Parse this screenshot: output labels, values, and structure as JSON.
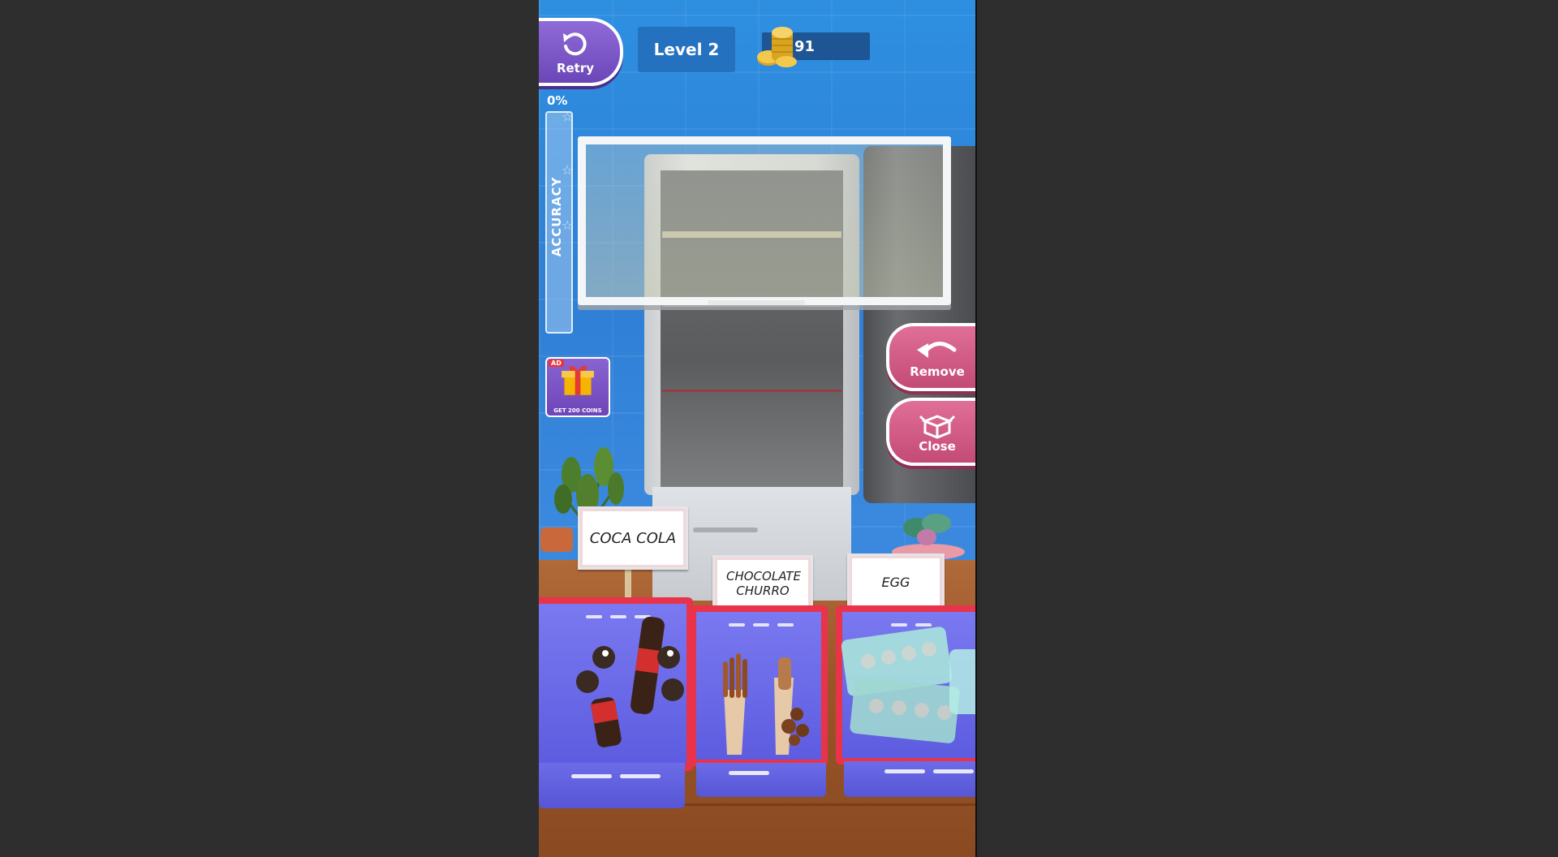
{
  "hud": {
    "retry_label": "Retry",
    "level_label": "Level 2",
    "coins": "91"
  },
  "accuracy": {
    "percent_label": "0%",
    "label": "ACCURACY",
    "value_percent": 0
  },
  "gift": {
    "ad_tag": "AD",
    "label": "GET 200 COINS"
  },
  "actions": {
    "remove_label": "Remove",
    "close_label": "Close"
  },
  "baskets": [
    {
      "sign": "COCA COLA"
    },
    {
      "sign": "CHOCOLATE CHURRO"
    },
    {
      "sign": "EGG"
    }
  ],
  "colors": {
    "retry": "#7a56c8",
    "action": "#d45b85",
    "basket_rim": "#e8334a",
    "basket_body": "#6a6ae8"
  }
}
